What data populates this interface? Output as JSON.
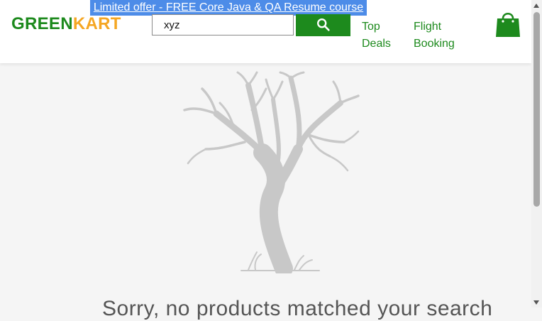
{
  "promo": {
    "text": "Limited offer - FREE Core Java & QA Resume course"
  },
  "logo": {
    "part1": "GREEN",
    "part2": "KART"
  },
  "search": {
    "value": "xyz"
  },
  "nav": {
    "top_deals": "Top\nDeals",
    "flight_booking": "Flight\nBooking"
  },
  "empty_state": {
    "message": "Sorry, no products matched your search"
  },
  "colors": {
    "brand_green": "#1d8a1d",
    "brand_orange": "#f5a623",
    "promo_blue": "#4d8ce8"
  }
}
